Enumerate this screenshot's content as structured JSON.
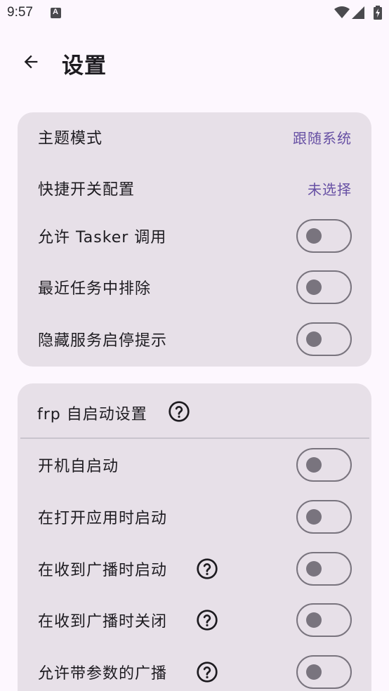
{
  "status_bar": {
    "time": "9:57",
    "notification_icon": "app-a-icon",
    "icons": [
      "wifi-icon",
      "cell-signal-icon",
      "battery-charging-icon"
    ]
  },
  "app_bar": {
    "back_icon": "arrow-back-icon",
    "title": "设置"
  },
  "general_card": {
    "rows": [
      {
        "label": "主题模式",
        "value": "跟随系统"
      },
      {
        "label": "快捷开关配置",
        "value": "未选择"
      },
      {
        "label": "允许 Tasker 调用",
        "toggle": false
      },
      {
        "label": "最近任务中排除",
        "toggle": false
      },
      {
        "label": "隐藏服务启停提示",
        "toggle": false
      }
    ]
  },
  "frp_card": {
    "header": "frp 自启动设置",
    "header_help_icon": "help-circle-icon",
    "rows": [
      {
        "label": "开机自启动",
        "toggle": false,
        "help": false
      },
      {
        "label": "在打开应用时启动",
        "toggle": false,
        "help": false
      },
      {
        "label": "在收到广播时启动",
        "toggle": false,
        "help": true
      },
      {
        "label": "在收到广播时关闭",
        "toggle": false,
        "help": true
      },
      {
        "label": "允许带参数的广播",
        "toggle": false,
        "help": true
      }
    ]
  },
  "colors": {
    "background": "#fdf7fe",
    "card": "#e7e0e8",
    "accent": "#6750a4",
    "outline": "#79747e",
    "text": "#1d1b20"
  }
}
